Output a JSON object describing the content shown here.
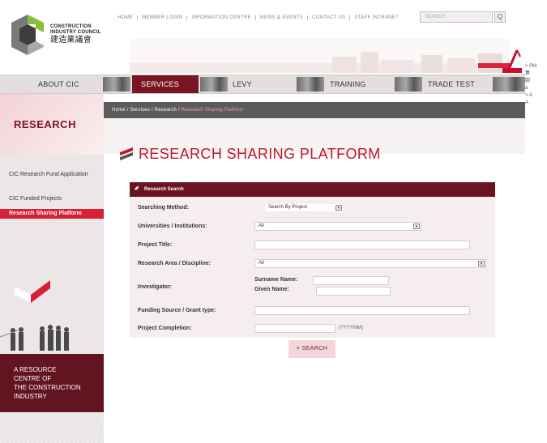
{
  "logo": {
    "line1": "CONSTRUCTION",
    "line2": "INDUSTRY COUNCIL",
    "zh": "建造業議會"
  },
  "topnav": {
    "items": [
      "HOME",
      "MEMBER LOGIN",
      "INFORMATION CENTRE",
      "NEWS & EVENTS",
      "CONTACT US",
      "STAFF INTRANET"
    ],
    "search_placeholder": "SEARCH",
    "search_go": "Q"
  },
  "right_edge": {
    "lines": [
      "> PM",
      "集",
      "図",
      "",
      "a",
      "> A",
      "A"
    ]
  },
  "mainnav": {
    "about": "ABOUT CIC",
    "services": "SERVICES",
    "levy": "LEVY",
    "training": "TRAINING",
    "trade_test": "TRADE TEST"
  },
  "sidebar": {
    "title": "RESEARCH",
    "items": [
      "CIC Research Fund Application",
      "CIC Funded Projects",
      "Research Sharing Platform"
    ],
    "tagline": [
      "A RESOURCE",
      "CENTRE OF",
      "THE CONSTRUCTION",
      "INDUSTRY"
    ]
  },
  "breadcrumb": {
    "home": "Home",
    "services": "Services",
    "research": "Research",
    "current": "Research Sharing Platform",
    "separator": "/"
  },
  "page": {
    "title": "RESEARCH SHARING PLATFORM"
  },
  "form": {
    "header": "Research Search",
    "searching_method_label": "Searching Method:",
    "searching_method_value": "Search By Project",
    "universities_label": "Universities / Institutions:",
    "universities_value": "All",
    "project_title_label": "Project Title:",
    "project_title_value": "",
    "research_area_label": "Research Area / Discipline:",
    "research_area_value": "All",
    "investigator_label": "Investigator:",
    "surname_label": "Surname Name:",
    "given_label": "Given Name:",
    "funding_label": "Funding Source / Grant type:",
    "completion_label": "Project Completion:",
    "completion_format": "(YYYYMM)",
    "search_button": "> SEARCH"
  },
  "colors": {
    "brand_maroon": "#6b1420",
    "accent_red": "#d71f36",
    "title_red": "#c0162a"
  }
}
